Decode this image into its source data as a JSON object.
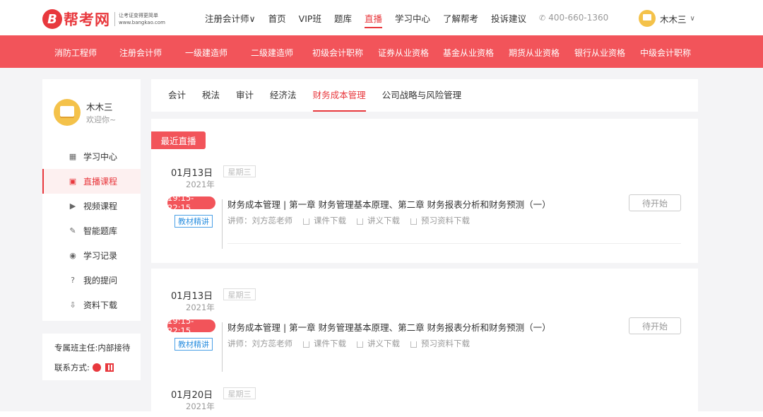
{
  "brand": {
    "name": "帮考网",
    "mark": "B",
    "slogan1": "让考证变得更简单",
    "slogan2": "www.bangkao.com"
  },
  "topnav": {
    "items": [
      "注册会计师∨",
      "首页",
      "VIP班",
      "题库",
      "直播",
      "学习中心",
      "了解帮考",
      "投诉建议"
    ],
    "active_index": 4,
    "phone": "400-660-1360"
  },
  "user": {
    "name": "木木三",
    "welcome": "欢迎你~"
  },
  "categories": [
    "消防工程师",
    "注册会计师",
    "一级建造师",
    "二级建造师",
    "初级会计职称",
    "证券从业资格",
    "基金从业资格",
    "期货从业资格",
    "银行从业资格",
    "中级会计职称"
  ],
  "sidebar": {
    "items": [
      {
        "label": "学习中心",
        "icon": "book-icon"
      },
      {
        "label": "直播课程",
        "icon": "live-icon"
      },
      {
        "label": "视频课程",
        "icon": "video-icon"
      },
      {
        "label": "智能题库",
        "icon": "question-bank-icon"
      },
      {
        "label": "学习记录",
        "icon": "record-icon"
      },
      {
        "label": "我的提问",
        "icon": "question-icon"
      },
      {
        "label": "资料下载",
        "icon": "download-icon"
      }
    ],
    "active_index": 1
  },
  "teacher": {
    "label": "专属班主任:",
    "value": "内部接待",
    "contact_label": "联系方式:"
  },
  "subtabs": {
    "items": [
      "会计",
      "税法",
      "审计",
      "经济法",
      "财务成本管理",
      "公司战略与风险管理"
    ],
    "active_index": 4
  },
  "section_badge": "最近直播",
  "courses": [
    {
      "date": "01月13日",
      "weekday": "星期三",
      "year": "2021年",
      "time": "19:15-22:15",
      "tag": "教材精讲",
      "title": "财务成本管理 | 第一章 财务管理基本原理、第二章 财务报表分析和财务预测（一）",
      "teacher": "讲师：刘方蕊老师",
      "links": [
        "课件下载",
        "讲义下载",
        "预习资料下载"
      ],
      "status": "待开始"
    },
    {
      "date": "01月13日",
      "weekday": "星期三",
      "year": "2021年",
      "time": "19:15-22:15",
      "tag": "教材精讲",
      "title": "财务成本管理 | 第一章 财务管理基本原理、第二章 财务报表分析和财务预测（一）",
      "teacher": "讲师：刘方蕊老师",
      "links": [
        "课件下载",
        "讲义下载",
        "预习资料下载"
      ],
      "status": "待开始"
    },
    {
      "date": "01月20日",
      "weekday": "星期三",
      "year": "2021年"
    }
  ],
  "colors": {
    "accent": "#e8383d",
    "redbar": "#f2545a",
    "tag_blue": "#2b8fe0"
  }
}
